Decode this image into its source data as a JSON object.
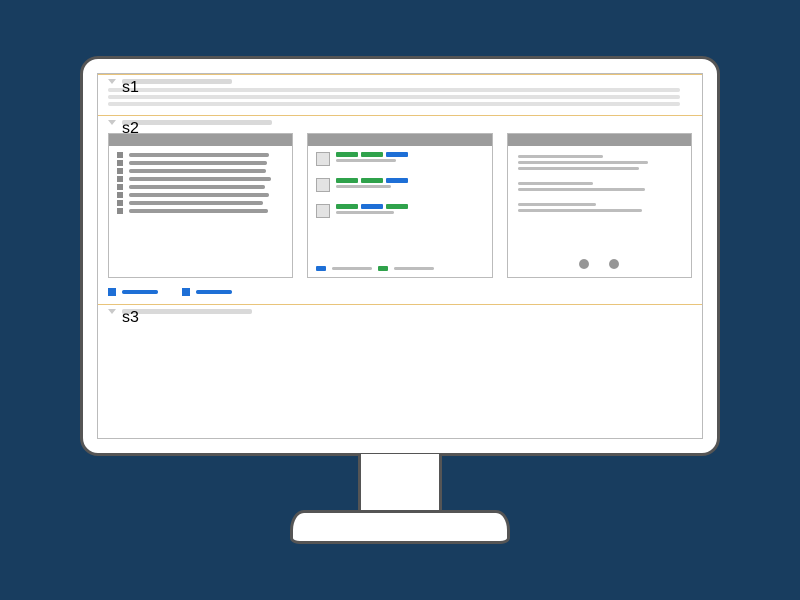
{
  "meta": {
    "kind": "wireframe-dashboard-mock",
    "note": "All text in the source image is abstract placeholder bars; no literal strings are readable."
  },
  "colors": {
    "background": "#183d5f",
    "frame": "#555555",
    "panel": "#ffffff",
    "divider": "#e9c47a",
    "accent_blue": "#1e6fd6",
    "accent_green": "#2fa24b",
    "grey": "#9c9c9c"
  },
  "sections": [
    {
      "id": "s1",
      "expanded": true,
      "row_count": 3
    },
    {
      "id": "s2",
      "expanded": true,
      "has_cards": true
    },
    {
      "id": "s3",
      "expanded": true
    }
  ],
  "cards": {
    "list_card": {
      "rows": 8
    },
    "status_card": {
      "items": [
        {
          "tags": [
            "green",
            "green",
            "blue"
          ]
        },
        {
          "tags": [
            "green",
            "green",
            "blue"
          ]
        },
        {
          "tags": [
            "green",
            "blue",
            "green"
          ]
        }
      ],
      "legend": [
        "blue",
        "green"
      ]
    },
    "detail_card": {
      "groups": [
        3,
        2,
        2
      ],
      "pager_dots": 2
    }
  },
  "tags_row": {
    "items": [
      {
        "color": "blue"
      },
      {
        "color": "blue"
      }
    ]
  }
}
